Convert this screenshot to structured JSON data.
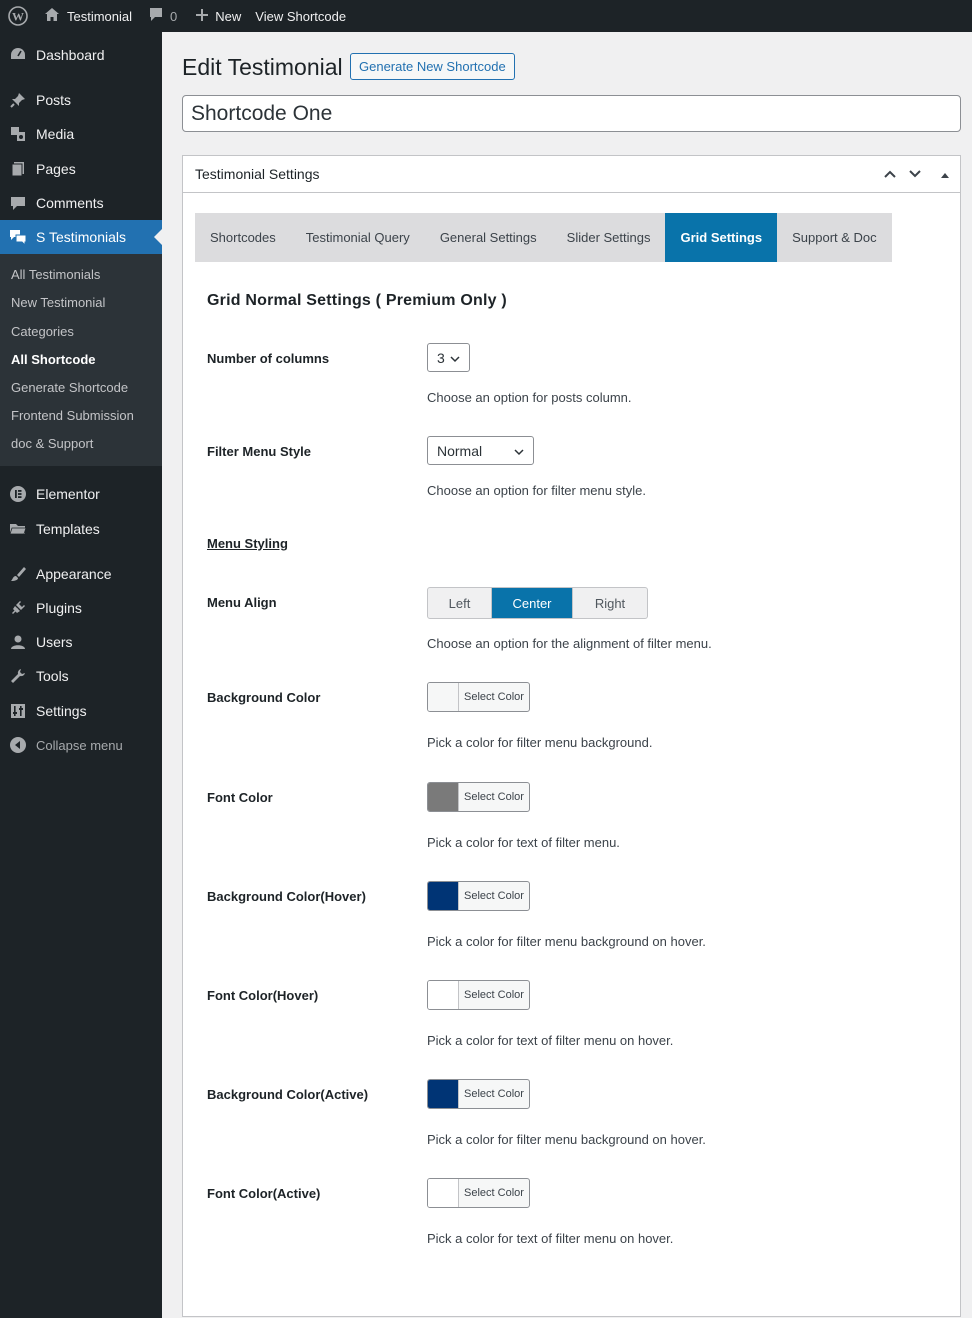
{
  "adminbar": {
    "site_name": "Testimonial",
    "comments_count": "0",
    "new_label": "New",
    "view_label": "View Shortcode"
  },
  "sidebar": {
    "items": [
      {
        "label": "Dashboard",
        "icon": "dashboard-icon"
      },
      {
        "label": "Posts",
        "icon": "pin-icon"
      },
      {
        "label": "Media",
        "icon": "media-icon"
      },
      {
        "label": "Pages",
        "icon": "pages-icon"
      },
      {
        "label": "Comments",
        "icon": "comment-icon"
      },
      {
        "label": "S Testimonials",
        "icon": "testimonial-icon"
      },
      {
        "label": "Elementor",
        "icon": "elementor-icon"
      },
      {
        "label": "Templates",
        "icon": "folder-icon"
      },
      {
        "label": "Appearance",
        "icon": "brush-icon"
      },
      {
        "label": "Plugins",
        "icon": "plug-icon"
      },
      {
        "label": "Users",
        "icon": "user-icon"
      },
      {
        "label": "Tools",
        "icon": "wrench-icon"
      },
      {
        "label": "Settings",
        "icon": "settings-icon"
      }
    ],
    "submenu": [
      "All Testimonials",
      "New Testimonial",
      "Categories",
      "All Shortcode",
      "Generate Shortcode",
      "Frontend Submission",
      "doc & Support"
    ],
    "collapse_label": "Collapse menu"
  },
  "header": {
    "title": "Edit Testimonial",
    "generate_button": "Generate New Shortcode",
    "shortcode_title": "Shortcode One"
  },
  "postbox": {
    "title": "Testimonial Settings",
    "tabs": [
      "Shortcodes",
      "Testimonial Query",
      "General Settings",
      "Slider Settings",
      "Grid Settings",
      "Support & Doc"
    ],
    "active_tab": "Grid Settings"
  },
  "grid": {
    "section_title": "Grid Normal Settings ( Premium Only )",
    "columns": {
      "label": "Number of columns",
      "value": "3",
      "desc": "Choose an option for posts column."
    },
    "filter_style": {
      "label": "Filter Menu Style",
      "value": "Normal",
      "desc": "Choose an option for filter menu style."
    },
    "menu_styling_label": "Menu Styling",
    "menu_align": {
      "label": "Menu Align",
      "options": [
        "Left",
        "Center",
        "Right"
      ],
      "selected": "Center",
      "desc": "Choose an option for the alignment of filter menu."
    },
    "select_color_label": "Select Color",
    "colors": [
      {
        "label": "Background Color",
        "swatch": "#f6f7f7",
        "desc": "Pick a color for filter menu background."
      },
      {
        "label": "Font Color",
        "swatch": "#7a7a7a",
        "desc": "Pick a color for text of filter menu."
      },
      {
        "label": "Background Color(Hover)",
        "swatch": "#003475",
        "desc": "Pick a color for filter menu background on hover."
      },
      {
        "label": "Font Color(Hover)",
        "swatch": "#ffffff",
        "desc": "Pick a color for text of filter menu on hover."
      },
      {
        "label": "Background Color(Active)",
        "swatch": "#003475",
        "desc": "Pick a color for filter menu background on hover."
      },
      {
        "label": "Font Color(Active)",
        "swatch": "#ffffff",
        "desc": "Pick a color for text of filter menu on hover."
      }
    ]
  }
}
